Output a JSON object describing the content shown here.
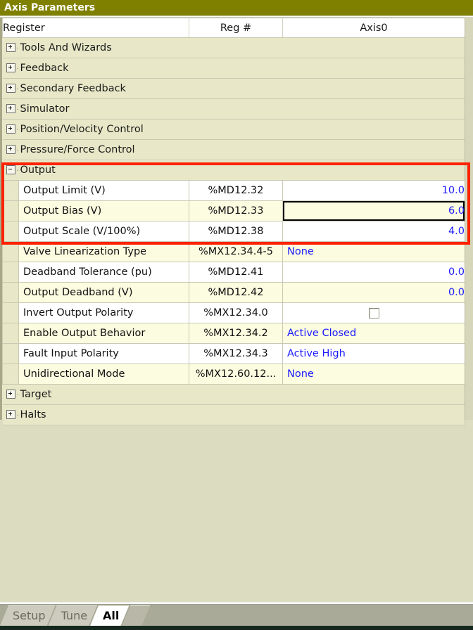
{
  "window": {
    "title": "Axis Parameters"
  },
  "grid": {
    "columns": [
      "Register",
      "Reg #",
      "Axis0"
    ],
    "rows": [
      {
        "kind": "group",
        "label": "Tools And Wizards",
        "expanded": false
      },
      {
        "kind": "group",
        "label": "Feedback",
        "expanded": false
      },
      {
        "kind": "group",
        "label": "Secondary Feedback",
        "expanded": false
      },
      {
        "kind": "group",
        "label": "Simulator",
        "expanded": false
      },
      {
        "kind": "group",
        "label": "Position/Velocity Control",
        "expanded": false
      },
      {
        "kind": "group",
        "label": "Pressure/Force Control",
        "expanded": false
      },
      {
        "kind": "group",
        "label": "Output",
        "expanded": true
      },
      {
        "kind": "item",
        "label": "Output Limit (V)",
        "reg": "%MD12.32",
        "value": "10.0",
        "align": "right",
        "selected": false
      },
      {
        "kind": "item",
        "label": "Output Bias (V)",
        "reg": "%MD12.33",
        "value": "6.0",
        "align": "right",
        "selected": true
      },
      {
        "kind": "item",
        "label": "Output Scale (V/100%)",
        "reg": "%MD12.38",
        "value": "4.0",
        "align": "right",
        "selected": false
      },
      {
        "kind": "item",
        "label": "Valve Linearization Type",
        "reg": "%MX12.34.4-5",
        "value": "None",
        "align": "left",
        "selected": false
      },
      {
        "kind": "item",
        "label": "Deadband Tolerance (pu)",
        "reg": "%MD12.41",
        "value": "0.0",
        "align": "right",
        "selected": false
      },
      {
        "kind": "item",
        "label": "Output Deadband (V)",
        "reg": "%MD12.42",
        "value": "0.0",
        "align": "right",
        "selected": false
      },
      {
        "kind": "item",
        "label": "Invert Output Polarity",
        "reg": "%MX12.34.0",
        "value": "",
        "align": "checkbox",
        "checked": false,
        "selected": false
      },
      {
        "kind": "item",
        "label": "Enable Output Behavior",
        "reg": "%MX12.34.2",
        "value": "Active Closed",
        "align": "left",
        "selected": false
      },
      {
        "kind": "item",
        "label": "Fault Input Polarity",
        "reg": "%MX12.34.3",
        "value": "Active High",
        "align": "left",
        "selected": false
      },
      {
        "kind": "item",
        "label": "Unidirectional Mode",
        "reg": "%MX12.60.12...",
        "value": "None",
        "align": "left",
        "selected": false
      },
      {
        "kind": "group",
        "label": "Target",
        "expanded": false
      },
      {
        "kind": "group",
        "label": "Halts",
        "expanded": false
      }
    ]
  },
  "annotation": {
    "color": "#ff2200",
    "shape": "rectangle",
    "covers": "Output group: Output Limit (V), Output Bias (V), Output Scale (V/100%)"
  },
  "tabs": [
    {
      "label": "Setup",
      "active": false
    },
    {
      "label": "Tune",
      "active": false
    },
    {
      "label": "All",
      "active": true
    }
  ],
  "colors": {
    "title_bar": "#808000",
    "group_row": "#e8e8c8",
    "row_tint": "#fcfce0",
    "value_text": "#1a1aff",
    "highlight": "#ff2200"
  }
}
